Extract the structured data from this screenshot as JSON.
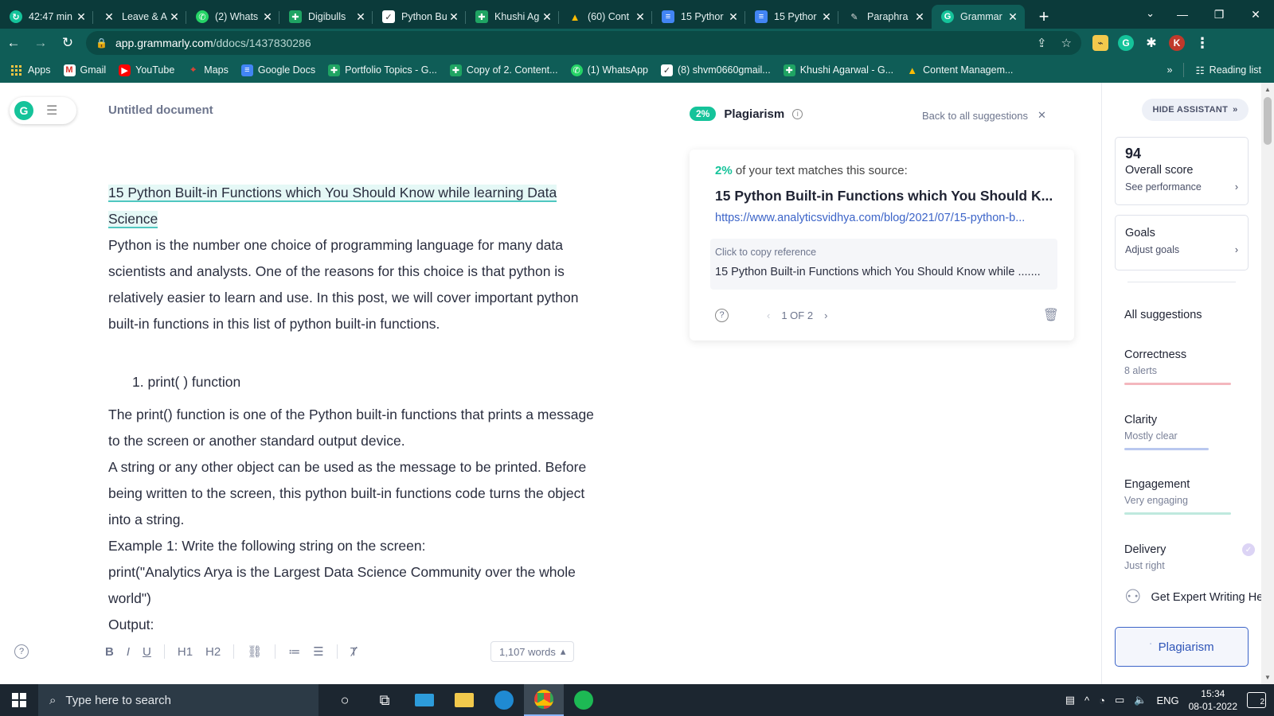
{
  "tabs": [
    {
      "title": "42:47 min",
      "icon": "refresh-icon",
      "close": "✕"
    },
    {
      "title": "Leave & A",
      "icon": "x-logo-icon",
      "close": "✕"
    },
    {
      "title": "(2) Whats",
      "icon": "whatsapp-icon",
      "close": "✕"
    },
    {
      "title": "Digibulls",
      "icon": "sheets-icon",
      "close": "✕"
    },
    {
      "title": "Python Bu",
      "icon": "python-icon",
      "close": "✕"
    },
    {
      "title": "Khushi Ag",
      "icon": "sheets-icon",
      "close": "✕"
    },
    {
      "title": "(60) Cont",
      "icon": "drive-icon",
      "close": "✕"
    },
    {
      "title": "15 Pythor",
      "icon": "docs-icon",
      "close": "✕"
    },
    {
      "title": "15 Pythor",
      "icon": "docs-icon",
      "close": "✕"
    },
    {
      "title": "Paraphra",
      "icon": "quill-icon",
      "close": "✕"
    },
    {
      "title": "Grammar",
      "icon": "grammarly-icon",
      "close": "✕",
      "active": true
    }
  ],
  "omnibox": {
    "host": "app.grammarly.com",
    "path": "/ddocs/1437830286"
  },
  "bookmarks": [
    {
      "label": "Apps",
      "icon": "apps-grid-icon"
    },
    {
      "label": "Gmail",
      "icon": "gmail-icon"
    },
    {
      "label": "YouTube",
      "icon": "youtube-icon"
    },
    {
      "label": "Maps",
      "icon": "maps-icon"
    },
    {
      "label": "Google Docs",
      "icon": "docs-icon"
    },
    {
      "label": "Portfolio Topics - G...",
      "icon": "sheets-icon"
    },
    {
      "label": "Copy of 2. Content...",
      "icon": "sheets-icon"
    },
    {
      "label": "(1) WhatsApp",
      "icon": "whatsapp-icon"
    },
    {
      "label": "(8) shvm0660gmail...",
      "icon": "checkbox-icon"
    },
    {
      "label": "Khushi Agarwal - G...",
      "icon": "sheets-icon"
    },
    {
      "label": "Content Managem...",
      "icon": "drive-icon"
    }
  ],
  "bookmarks_right": {
    "more": "»",
    "reading_list": "Reading list"
  },
  "extensions": {
    "avatar_letter": "K"
  },
  "doc": {
    "title": "Untitled document",
    "heading": "15 Python Built-in Functions which You Should Know while learning Data Science",
    "intro": "Python is the number one choice of programming language for many data scientists and analysts. One of the reasons for this choice is that python is relatively easier to learn and use. In this post, we will cover important python built-in functions in this list of python built-in functions.",
    "list_item": "1.  print( ) function",
    "p1": "The print() function is one of the Python built-in functions that prints a message to the screen or another standard output device.",
    "p2": "A string or any other object can be used as the message to be printed. Before being written to the screen, this python built-in functions code turns the object into a string.",
    "p3": "Example 1: Write the following string on the screen:",
    "p4": "print(\"Analytics Arya is the Largest Data Science Community over the whole world\")",
    "p5": "Output:"
  },
  "editor_toolbar": {
    "help": "?",
    "bold": "B",
    "italic": "I",
    "underline": "U",
    "h1": "H1",
    "h2": "H2",
    "link": "🔗",
    "ordered": "⒈",
    "bulleted": "☰",
    "clear": "T̸",
    "word_count": "1,107 words",
    "word_count_arrow": "▴"
  },
  "plagiarism": {
    "badge": "2%",
    "title": "Plagiarism",
    "back_label": "Back to all suggestions",
    "match_pct": "2%",
    "match_text": " of your text matches this source:",
    "source_title": "15 Python Built-in Functions which You Should K...",
    "source_url": "https://www.analyticsvidhya.com/blog/2021/07/15-python-b...",
    "ref_label": "Click to copy reference",
    "ref_text": "15 Python Built-in Functions which You Should Know while .......",
    "pager": "1 OF 2"
  },
  "assistant": {
    "hide_label": "HIDE ASSISTANT",
    "score": "94",
    "score_label": "Overall score",
    "score_link": "See performance",
    "goals_title": "Goals",
    "goals_link": "Adjust goals",
    "all_suggestions": "All suggestions",
    "categories": [
      {
        "name": "Correctness",
        "sub": "8 alerts",
        "color": "#f4b7be"
      },
      {
        "name": "Clarity",
        "sub": "Mostly clear",
        "color": "#b9c8ef"
      },
      {
        "name": "Engagement",
        "sub": "Very engaging",
        "color": "#bfe9de"
      },
      {
        "name": "Delivery",
        "sub": "Just right",
        "color": "#dcd4f5"
      }
    ],
    "expert_label": "Get Expert Writing Help",
    "plagiarism_button": "Plagiarism"
  },
  "taskbar": {
    "search_placeholder": "Type here to search",
    "language": "ENG",
    "time": "15:34",
    "date": "08-01-2022",
    "notifications": "2"
  },
  "colors": {
    "brand": "#15c39a",
    "chrome_dark": "#0b3a3a",
    "chrome": "#0f5d57",
    "link": "#3c64c8"
  }
}
